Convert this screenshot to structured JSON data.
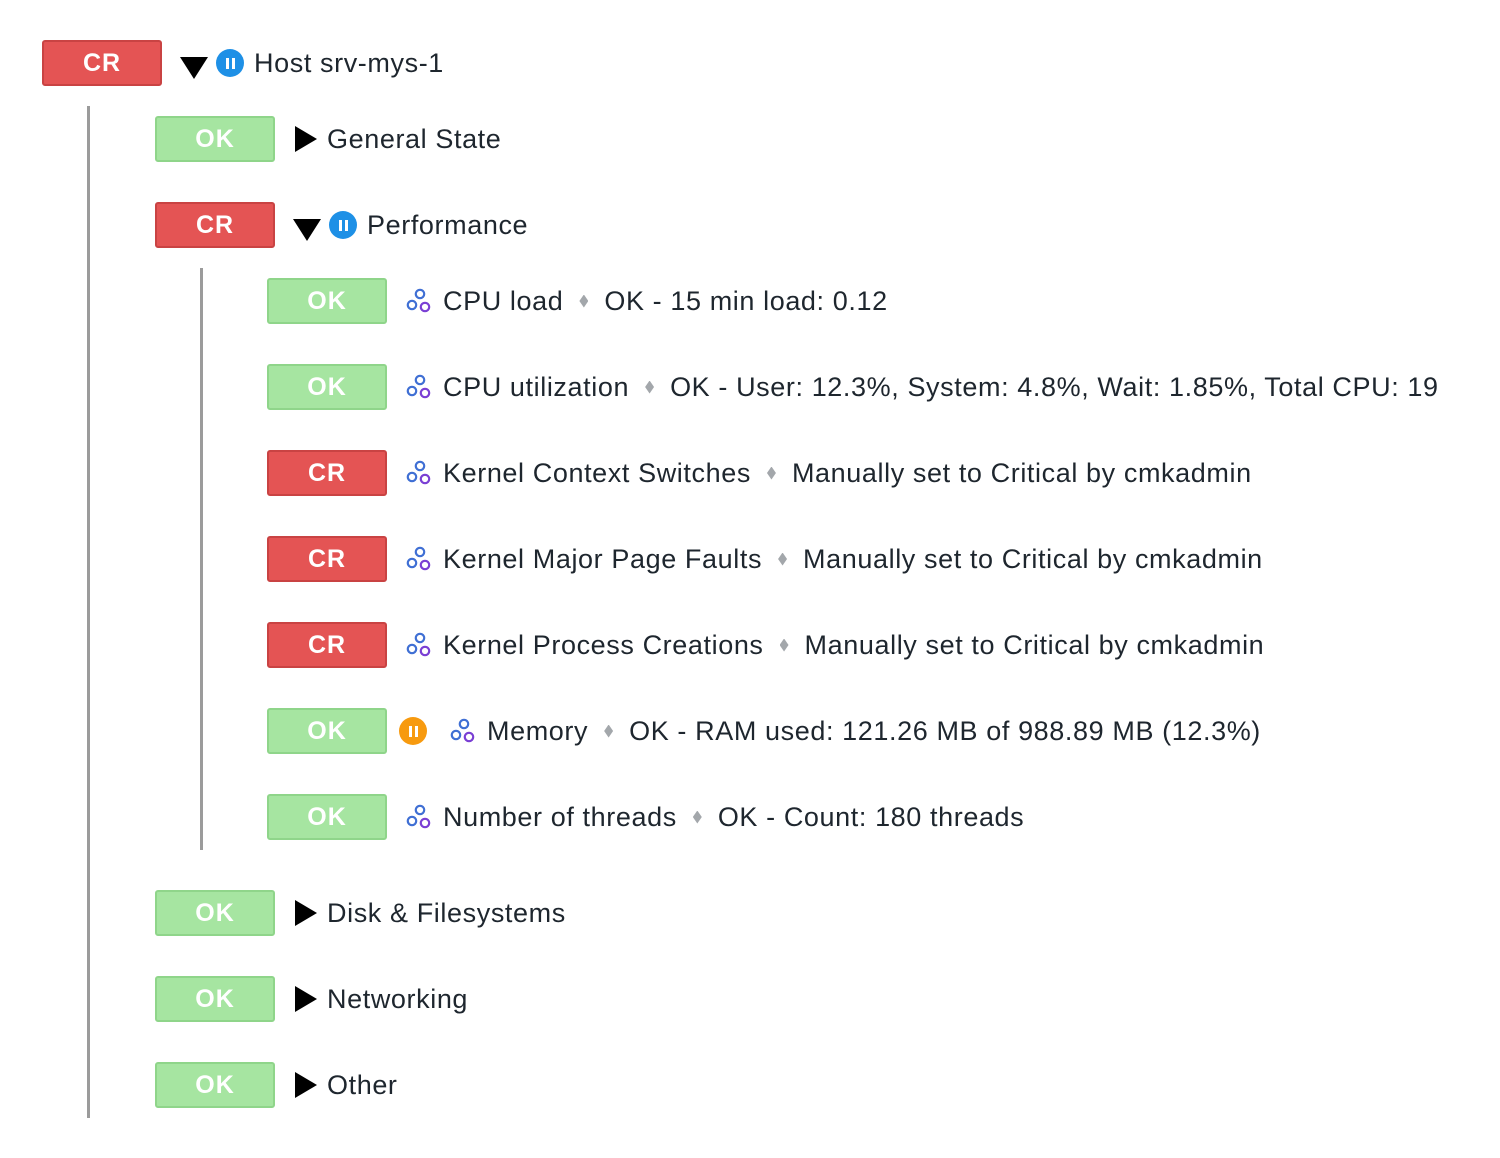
{
  "host": {
    "state": "CR",
    "label": "Host srv-mys-1"
  },
  "groups": [
    {
      "state": "OK",
      "label": "General State"
    },
    {
      "state": "CR",
      "label": "Performance"
    },
    {
      "state": "OK",
      "label": "Disk & Filesystems"
    },
    {
      "state": "OK",
      "label": "Networking"
    },
    {
      "state": "OK",
      "label": "Other"
    }
  ],
  "services": [
    {
      "state": "OK",
      "name": "CPU load",
      "output": "OK - 15 min load: 0.12"
    },
    {
      "state": "OK",
      "name": "CPU utilization",
      "output": "OK - User: 12.3%, System: 4.8%, Wait: 1.85%, Total CPU: 19"
    },
    {
      "state": "CR",
      "name": "Kernel Context Switches",
      "output": "Manually set to Critical by cmkadmin"
    },
    {
      "state": "CR",
      "name": "Kernel Major Page Faults",
      "output": "Manually set to Critical by cmkadmin"
    },
    {
      "state": "CR",
      "name": "Kernel Process Creations",
      "output": "Manually set to Critical by cmkadmin"
    },
    {
      "state": "OK",
      "name": "Memory",
      "output": "OK - RAM used: 121.26 MB of 988.89 MB (12.3%)"
    },
    {
      "state": "OK",
      "name": "Number of threads",
      "output": "OK - Count: 180 threads"
    }
  ],
  "icons": {
    "expand": "triangle-down-icon",
    "collapse": "triangle-right-icon",
    "downtime": "pause-icon",
    "service": "gears-icon"
  },
  "colors": {
    "ok": "#a6e5a1",
    "crit": "#e45454",
    "pause_blue": "#1e90e6",
    "pause_orange": "#f79a0f"
  }
}
